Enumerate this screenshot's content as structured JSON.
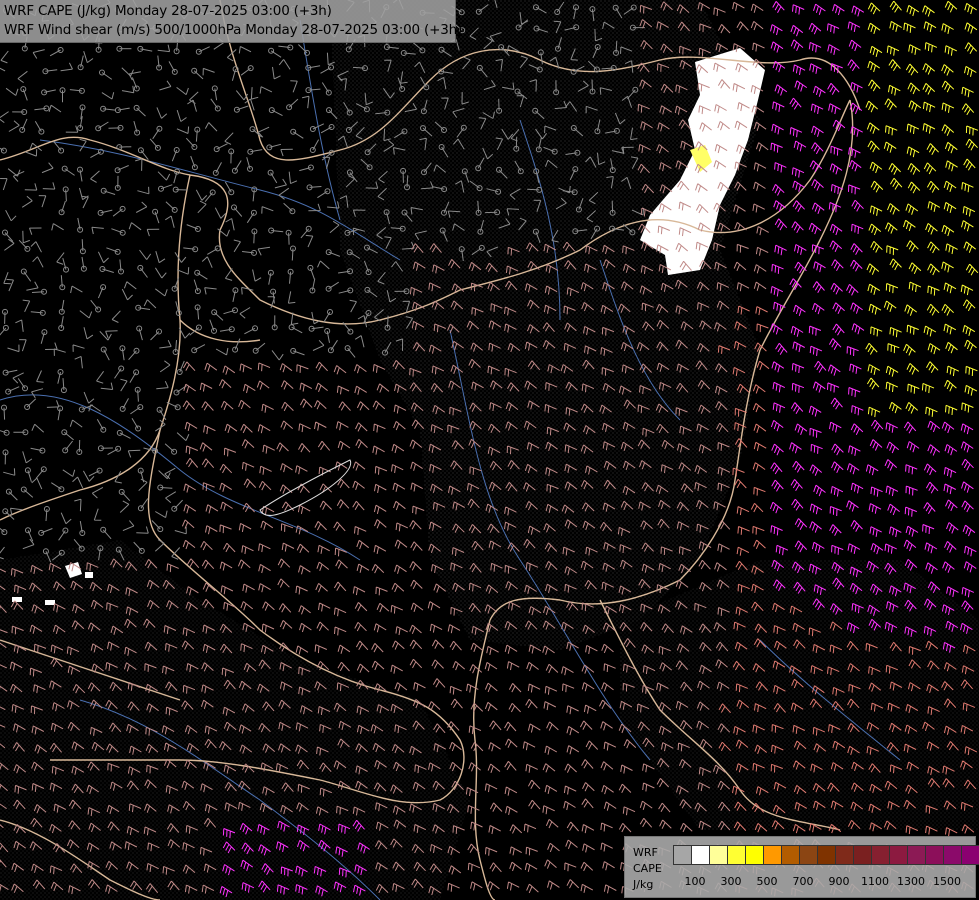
{
  "titles": {
    "line1": "WRF CAPE (J/kg) Monday 28-07-2025 03:00 (+3h)",
    "line2": "WRF Wind shear (m/s) 500/1000hPa Monday 28-07-2025 03:00 (+3h)"
  },
  "legend": {
    "model": "WRF",
    "field": "CAPE",
    "unit": "J/kg",
    "colors": [
      "#a6a6a6",
      "#ffffff",
      "#ffff99",
      "#ffff33",
      "#ffff00",
      "#ff9900",
      "#b25c00",
      "#8b4513",
      "#7f3300",
      "#7f2a1a",
      "#7a2020",
      "#862030",
      "#8c1a40",
      "#8c1a55",
      "#8c0f5a",
      "#8b0a6a",
      "#8b0070"
    ],
    "ticks": [
      "100",
      "300",
      "500",
      "700",
      "900",
      "1100",
      "1300",
      "1500"
    ]
  },
  "map_colors": {
    "border": "#d8b898",
    "river": "#4a6fb0",
    "cape_zero_barb": "#8a8a8a",
    "shear_low": "#c08a88",
    "shear_mid": "#e07a70",
    "shear_high": "#ff33ff",
    "shear_max": "#ffff33"
  }
}
